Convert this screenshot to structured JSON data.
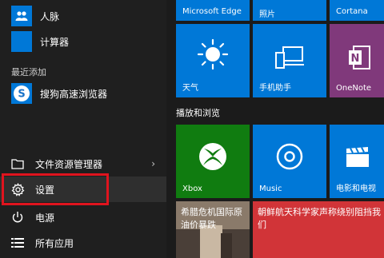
{
  "apps": {
    "contacts": "人脉",
    "calculator": "计算器",
    "recent_header": "最近添加",
    "sogou": "搜狗高速浏览器"
  },
  "menu": {
    "file_explorer": "文件资源管理器",
    "settings": "设置",
    "power": "电源",
    "all_apps": "所有应用"
  },
  "tiles": {
    "edge": "Microsoft Edge",
    "photos": "照片",
    "cortana": "Cortana",
    "weather": "天气",
    "phone": "手机助手",
    "onenote": "OneNote",
    "group_header": "播放和浏览",
    "xbox": "Xbox",
    "music": "Music",
    "movies": "电影和电视",
    "news1": "希腊危机国际原油价暴跌",
    "news2": "朝鲜航天科学家声称绕别阻挡我们"
  },
  "colors": {
    "accent_blue": "#0078d7",
    "xbox_green": "#107c10",
    "onenote_purple": "#80397b",
    "news_red": "#d13438"
  }
}
